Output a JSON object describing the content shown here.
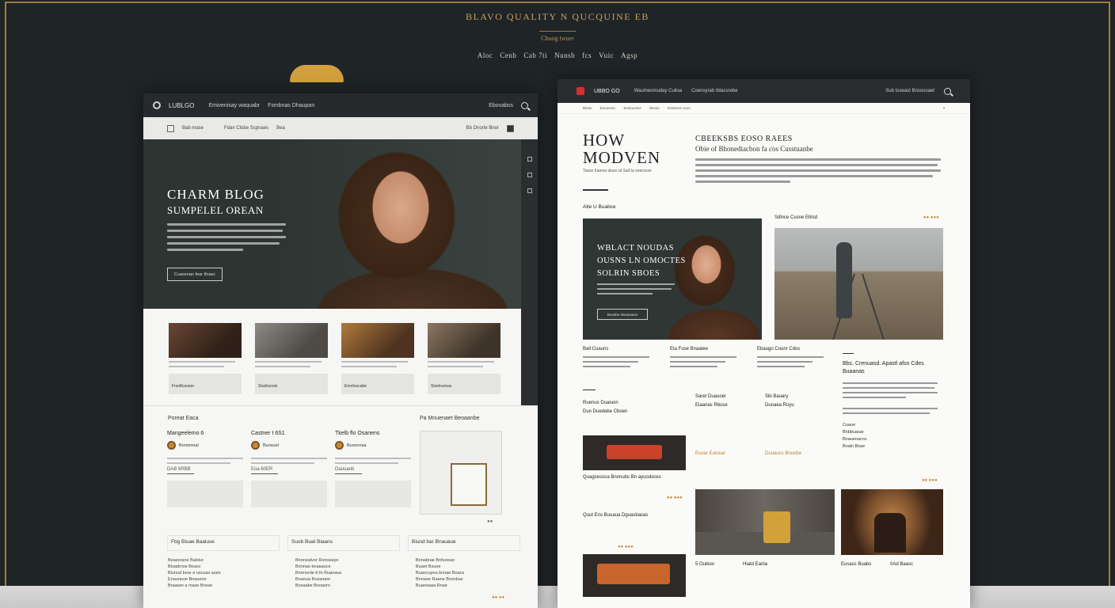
{
  "banner": {
    "title": "BLAVO QUALITY N QUCQUINE EB",
    "subtitle": "Chuog twuer",
    "nav": [
      "Aloc",
      "Cenb",
      "Cab 7ti",
      "Nunsb",
      "fcs",
      "Vuic",
      "Agsp"
    ]
  },
  "left_site": {
    "logo": "LUBLGO",
    "nav": [
      "Emivenisay waquabr",
      "Fsmbnas Dhaupan"
    ],
    "topbar_right": "Ebovabss",
    "subbar_logo": "Bab mase",
    "subbar_links": [
      "Fdan Clobe Scpnaes",
      "Bea"
    ],
    "subbar_right": "Bb Dnorte Bnor",
    "hero": {
      "title": "CHARM BLOG",
      "subtitle": "SUMPELEL OREAN",
      "button": "Cuasenan fear tfoasc"
    },
    "cards": [
      {
        "label": "Fnedfcaoare"
      },
      {
        "label": "Stueliuosie"
      },
      {
        "label": "Ennrloucabe"
      },
      {
        "label": "Stseloureas"
      }
    ],
    "section_label": "Poreat Eaca",
    "posts": [
      {
        "title": "Mangeelemo 6",
        "author": "Bonmnnal",
        "meta": "DAB 6RBB"
      },
      {
        "title": "Castner t 6S1",
        "author": "Buosuel",
        "meta": "Eoa 60ER"
      },
      {
        "title": "Tkelb flo Osanens",
        "author": "Buosnosa",
        "meta": "Daouanb"
      }
    ],
    "map_label": "Pa Mnuenaet Beoaanbe",
    "map_dots": "●●",
    "bottom_cols": [
      "Fbg Biuae Baaluse",
      "Suob Buat Biaans",
      "Biund bar Bnauaue"
    ],
    "lists": [
      [
        "Beasorane Baloke",
        "Biuadrnse Beasc",
        "Biunud bear e uscuas aues",
        "Enauneoe Bnauene",
        "Bnaawn a mase Bosse"
      ],
      [
        "Bnonealvor Ronoeaye",
        "Bnnnao bnaaauce",
        "Bnenorde b fn Ruanasa",
        "Bnaoua Rusaoare",
        "Bosaabe Bnoaoro"
      ],
      [
        "Bnnabrae Bnfuoeao",
        "Buaet Bsuoe",
        "Buaocuyea bnoae Boacs",
        "Bnnaoe Raane Bnsnbse",
        "Buanoaaa Rnae"
      ]
    ],
    "more": "●● ●●"
  },
  "right_site": {
    "logo": "UBBO GO",
    "nav": [
      "Waumeomuday Cuiloa",
      "Coensyrab tblacsrebe"
    ],
    "topbar_right": "Sub tsoeast Bnsoosaet",
    "subbar": [
      "Bbtas",
      "Baoanasc",
      "Bsabuedse",
      "Bbsae",
      "Daebeas saos"
    ],
    "title_line1": "HOW",
    "title_line2": "MODVEN",
    "title_sub": "Taaas fuanea alueo at Sad ia soerouse",
    "intro_head": "CBEEKSBS EOSO RAEES",
    "intro_sub": "Obie of Bhonediacbon fa cos Cusstuanbe",
    "featured_label": "Alte U Buabce",
    "feature": {
      "line1": "WBLACT NOUDAS",
      "line2": "OUSNS LN OMOCTES",
      "line3": "SOLRIN SBOES",
      "button": "Bnasbe dseasaase"
    },
    "rail_label": "Sdlnce Cusne Eblsd",
    "rail_dots": "●● ●●●",
    "minis": [
      {
        "title": "Ball Cuauns"
      },
      {
        "title": "Eta Fuse Bnaatee"
      },
      {
        "title": "Ebaugo Cuunr Cdos"
      }
    ],
    "side_head": "Bbs. Crenuasd. Apastl afso Cdes Buaanas",
    "side_items": [
      "Cuaue",
      "Bnbbuasar",
      "Bnaueoacos",
      "Boaln Bsae"
    ],
    "side_dots": "●● ●●●",
    "lower": [
      {
        "title": "Ruenus Duaiuon",
        "sub": "Duo Duedabe Cboen"
      },
      {
        "title": "Saret Duauoer",
        "sub": "Eiaanas Rbuse"
      },
      {
        "title": "Sbi Bauary",
        "sub": "Duoaea Ruyu"
      }
    ],
    "food_caption": "Quagsesoca Bnnnubs Bn ayuodoces",
    "food_dots": "●● ●●●",
    "lower_captions": [
      "Euoar Euiusar",
      "Duuaucs Bnuobe"
    ],
    "tail_caption": "Quut Ens Buuaua Dguasbasas",
    "tail_dots": "●● ●●●",
    "bottom_caps": [
      "5 Oukloo",
      "Hiatd Eanla",
      "Eusasc Buabs",
      "0Ad Baasc"
    ]
  }
}
